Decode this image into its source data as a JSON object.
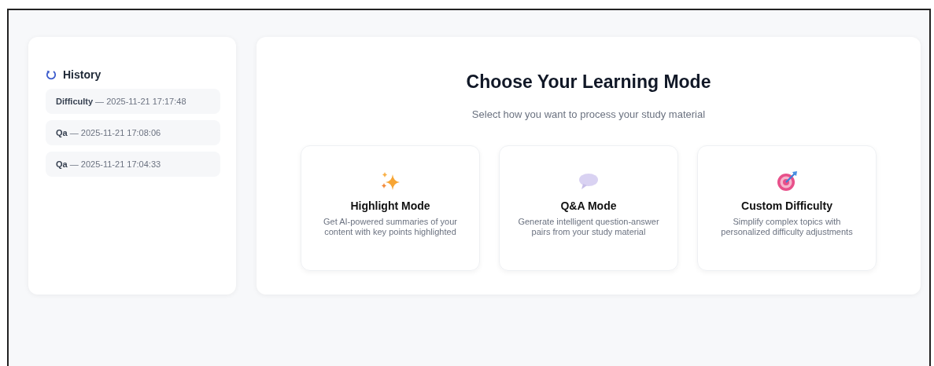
{
  "history": {
    "title": "History",
    "items": [
      {
        "mode": "Difficulty",
        "time": "— 2025-11-21 17:17:48"
      },
      {
        "mode": "Qa",
        "time": "— 2025-11-21 17:08:06"
      },
      {
        "mode": "Qa",
        "time": "— 2025-11-21 17:04:33"
      }
    ]
  },
  "main": {
    "title": "Choose Your Learning Mode",
    "subtitle": "Select how you want to process your study material",
    "modes": [
      {
        "kind": "sparkles",
        "title": "Highlight Mode",
        "description": "Get AI-powered summaries of your content with key points highlighted"
      },
      {
        "kind": "speech",
        "title": "Q&A Mode",
        "description": "Generate intelligent question-answer pairs from your study material"
      },
      {
        "kind": "target",
        "title": "Custom Difficulty",
        "description": "Simplify complex topics with personalized difficulty adjustments"
      }
    ]
  }
}
